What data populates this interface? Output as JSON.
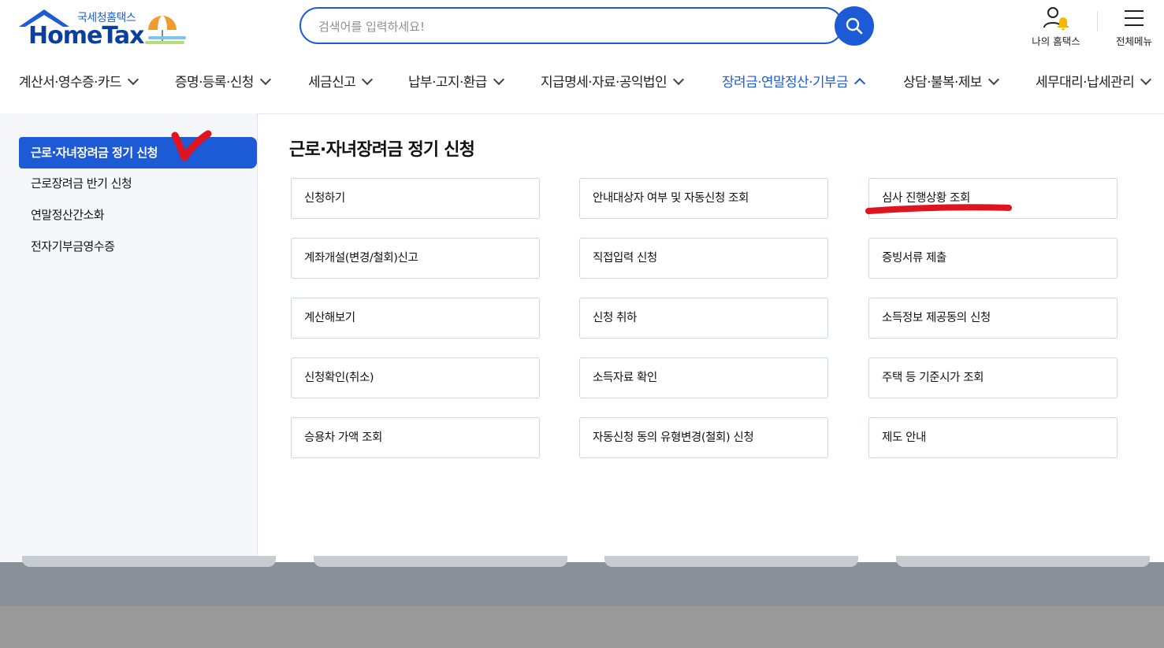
{
  "logo": {
    "kr_text": "국세청홈택스",
    "en_text": "HomeTax"
  },
  "search": {
    "placeholder": "검색어를 입력하세요!"
  },
  "util": {
    "my_hometax": "나의 홈택스",
    "all_menu": "전체메뉴"
  },
  "gnb": [
    "계산서·영수증·카드",
    "증명·등록·신청",
    "세금신고",
    "납부·고지·환급",
    "지급명세·자료·공익법인",
    "장려금·연말정산·기부금",
    "상담·불복·제보",
    "세무대리·납세관리"
  ],
  "gnb_active_index": 5,
  "side": [
    "근로·자녀장려금 정기 신청",
    "근로장려금 반기 신청",
    "연말정산간소화",
    "전자기부금영수증"
  ],
  "main": {
    "title": "근로·자녀장려금 정기 신청",
    "cards": [
      [
        "신청하기",
        "안내대상자 여부 및 자동신청 조회",
        "심사 진행상황 조회"
      ],
      [
        "계좌개설(변경/철회)신고",
        "직접입력 신청",
        "증빙서류 제출"
      ],
      [
        "계산해보기",
        "신청 취하",
        "소득정보 제공동의 신청"
      ],
      [
        "신청확인(취소)",
        "소득자료 확인",
        "주택 등 기준시가 조회"
      ],
      [
        "승용차 가액 조회",
        "자동신청 동의 유형변경(철회) 신청",
        "제도 안내"
      ]
    ]
  },
  "colors": {
    "accent": "#1d5bd6",
    "annotation": "#e0141e"
  }
}
